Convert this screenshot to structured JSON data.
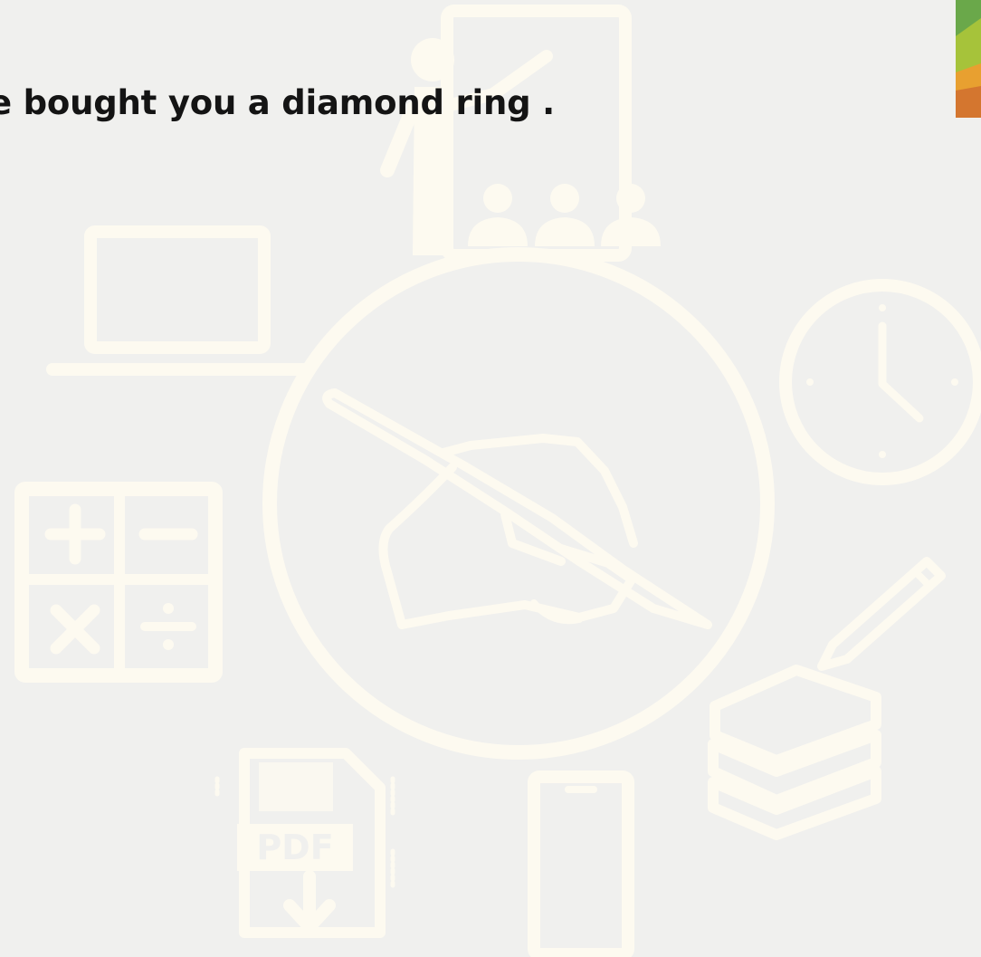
{
  "slide": {
    "sentence": "e bought you a diamond ring ."
  },
  "background": {
    "color": "#f0f0ee",
    "icon_color": "#fdfaf0",
    "icons": [
      "teacher-icon",
      "audience-icon",
      "laptop-icon",
      "writing-hand-icon",
      "clock-icon",
      "calculator-icon",
      "pencil-icon",
      "books-icon",
      "pdf-download-icon",
      "smartphone-icon"
    ]
  },
  "corner_swatch": {
    "colors": [
      "#7ab648",
      "#a6c33a",
      "#e8a030",
      "#d4762f"
    ]
  }
}
